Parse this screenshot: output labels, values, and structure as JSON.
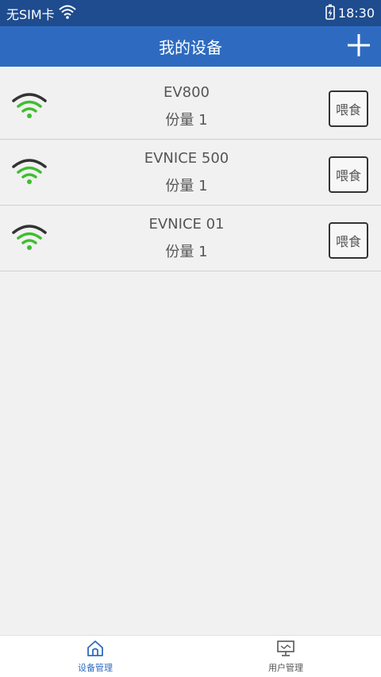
{
  "status_bar": {
    "carrier": "无SIM卡",
    "time": "18:30",
    "icons": [
      "wifi-icon",
      "battery-charging-icon"
    ]
  },
  "app_bar": {
    "title": "我的设备",
    "add_icon": "plus-icon"
  },
  "devices": [
    {
      "name": "EV800",
      "portion": "份量 1",
      "feed_label": "喂食",
      "signal_icon": "wifi-signal-icon"
    },
    {
      "name": "EVNICE 500",
      "portion": "份量 1",
      "feed_label": "喂食",
      "signal_icon": "wifi-signal-icon"
    },
    {
      "name": "EVNICE 01",
      "portion": "份量 1",
      "feed_label": "喂食",
      "signal_icon": "wifi-signal-icon"
    }
  ],
  "bottom_nav": {
    "items": [
      {
        "label": "设备管理",
        "icon": "home-icon",
        "active": true
      },
      {
        "label": "用户管理",
        "icon": "monitor-icon",
        "active": false
      }
    ]
  },
  "colors": {
    "status_bar": "#1e4c8e",
    "app_bar": "#2e6bc0",
    "signal_green": "#3dbf2c",
    "signal_dark": "#333333",
    "active_nav": "#2e6bc0"
  }
}
